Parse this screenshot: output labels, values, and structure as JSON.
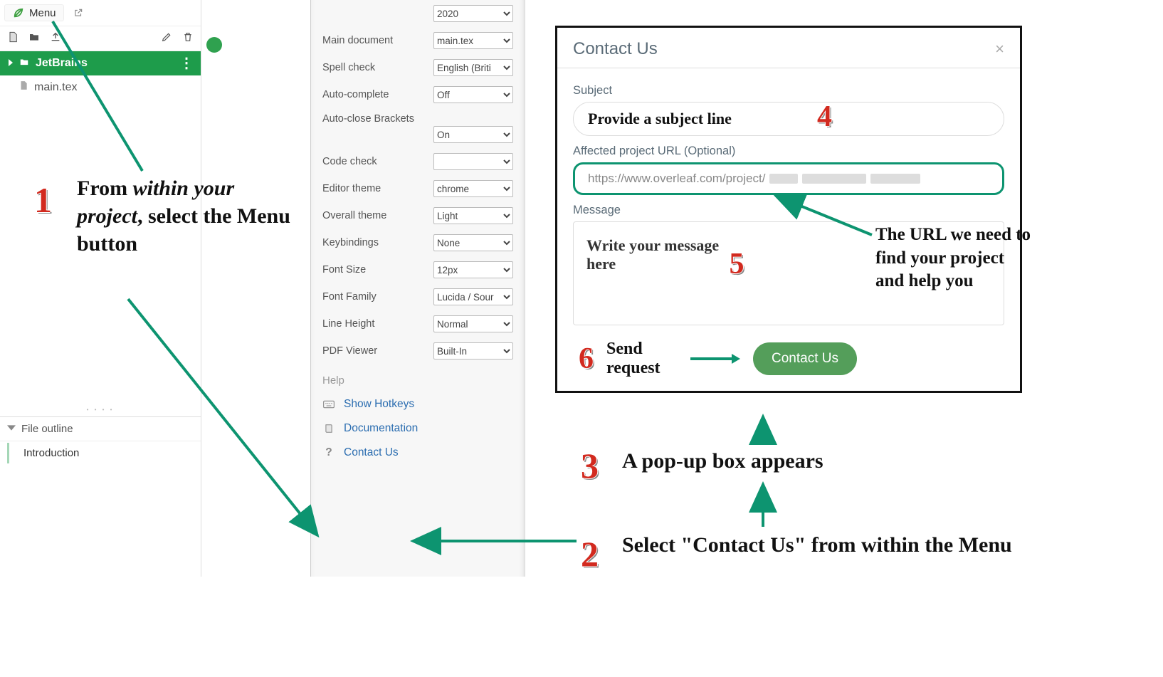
{
  "topbar": {
    "menu_label": "Menu"
  },
  "project": {
    "name": "JetBrains",
    "file": "main.tex"
  },
  "outline": {
    "title": "File outline",
    "item": "Introduction"
  },
  "settings": {
    "year": "2020",
    "main_doc_label": "Main document",
    "main_doc_val": "main.tex",
    "spell_label": "Spell check",
    "spell_val": "English (Briti",
    "auto_complete_label": "Auto-complete",
    "auto_complete_val": "Off",
    "auto_close_label": "Auto-close Brackets",
    "auto_close_val": "On",
    "code_check_label": "Code check",
    "code_check_val": "",
    "editor_theme_label": "Editor theme",
    "editor_theme_val": "chrome",
    "overall_theme_label": "Overall theme",
    "overall_theme_val": "Light",
    "keybind_label": "Keybindings",
    "keybind_val": "None",
    "font_size_label": "Font Size",
    "font_size_val": "12px",
    "font_family_label": "Font Family",
    "font_family_val": "Lucida / Sour",
    "line_height_label": "Line Height",
    "line_height_val": "Normal",
    "pdf_viewer_label": "PDF Viewer",
    "pdf_viewer_val": "Built-In",
    "help_label": "Help",
    "hotkeys": "Show Hotkeys",
    "documentation": "Documentation",
    "contact": "Contact Us"
  },
  "modal": {
    "title": "Contact Us",
    "subject_label": "Subject",
    "subject_placeholder": "Provide a subject line",
    "url_label": "Affected project URL (Optional)",
    "url_value": "https://www.overleaf.com/project/",
    "message_label": "Message",
    "message_placeholder": "Write your message here",
    "button": "Contact Us"
  },
  "ann": {
    "step1": "From within your project, select the Menu button",
    "step2": "Select \"Contact Us\" from within the Menu",
    "step3": "A pop-up box appears",
    "url_note": "The URL we need to find your project and help you",
    "send": "Send request"
  }
}
